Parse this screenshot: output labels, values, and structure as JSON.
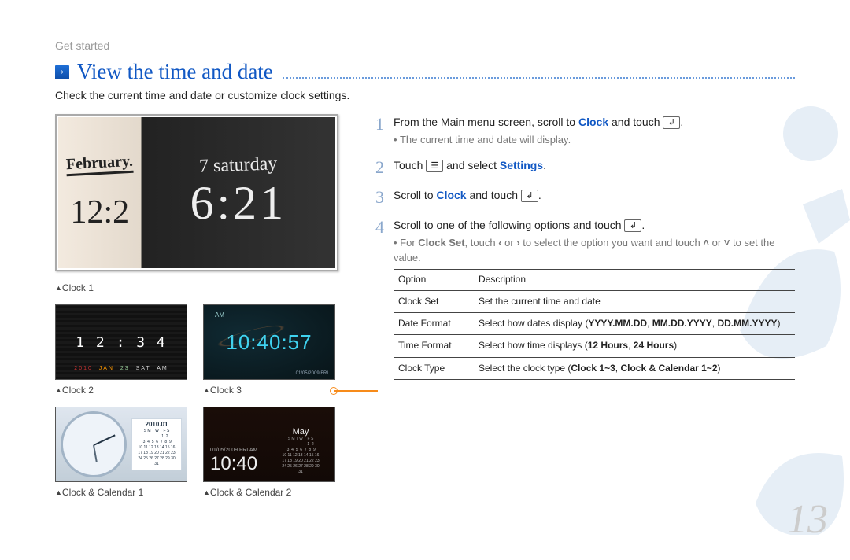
{
  "breadcrumb": "Get started",
  "title": "View the time and date",
  "intro": "Check the current time and date or customize clock settings.",
  "page_number": "13",
  "chalkboard": {
    "month": "February.",
    "time_dark": "12:2",
    "day": "7 saturday",
    "time_white": "6:21"
  },
  "captions": {
    "clock1": "Clock 1",
    "clock2": "Clock 2",
    "clock3": "Clock 3",
    "cal1": "Clock & Calendar 1",
    "cal2": "Clock & Calendar 2"
  },
  "thumbs": {
    "clock2": {
      "time": "1 2 : 3 4",
      "sub": {
        "year": "2010",
        "mon": "JAN",
        "day": "23",
        "wd": "SAT",
        "ap": "AM"
      }
    },
    "clock3": {
      "am": "AM",
      "time": "10:40:57",
      "date": "01/05/2009  FRI"
    },
    "cal1": {
      "header": "2010.01",
      "grid": "S M T W T F S\n               1  2\n 3  4  5  6  7  8  9\n10 11 12 13 14 15 16\n17 18 19 20 21 22 23\n24 25 26 27 28 29 30\n31"
    },
    "cal2": {
      "sub": "01/05/2009 FRI  AM",
      "time": "10:40",
      "month": "May",
      "head": "S M T W T F S",
      "grid": "                  1  2\n 3  4  5  6  7  8  9\n10 11 12 13 14 15 16\n17 18 19 20 21 22 23\n24 25 26 27 28 29 30\n31"
    }
  },
  "steps": {
    "s1": {
      "pre": "From the Main menu screen, scroll to ",
      "clock": "Clock",
      "post": " and touch ",
      "sub": "The current time and date will display."
    },
    "s2": {
      "pre": "Touch ",
      "post1": " and select ",
      "settings": "Settings",
      "post2": "."
    },
    "s3": {
      "pre": "Scroll to ",
      "clock": "Clock",
      "post": " and touch "
    },
    "s4": {
      "text": "Scroll to one of the following options and touch ",
      "sub_pre": "For ",
      "clockset": "Clock Set",
      "sub_mid1": ", touch ",
      "sub_mid2": " or ",
      "sub_mid3": " to select the option you want and touch ",
      "sub_mid4": " or ",
      "sub_end": " to set the value."
    }
  },
  "table": {
    "headers": [
      "Option",
      "Description"
    ],
    "rows": [
      {
        "opt": "Clock Set",
        "desc_plain": "Set the current time and date"
      },
      {
        "opt": "Date Format",
        "desc_pre": "Select how dates display (",
        "b1": "YYYY.MM.DD",
        "c1": ", ",
        "b2": "MM.DD.YYYY",
        "c2": ", ",
        "b3": "DD.MM.YYYY",
        "desc_post": ")"
      },
      {
        "opt": "Time Format",
        "desc_pre": "Select how time displays (",
        "b1": "12 Hours",
        "c1": ", ",
        "b2": "24 Hours",
        "desc_post": ")"
      },
      {
        "opt": "Clock Type",
        "desc_pre": "Select the clock type (",
        "b1": "Clock 1~3",
        "c1": ", ",
        "b2": "Clock & Calendar 1~2",
        "desc_post": ")"
      }
    ]
  },
  "icons": {
    "enter": "↲",
    "menu": "☰",
    "left": "‹",
    "right": "›",
    "up": "˄",
    "down": "˅"
  }
}
